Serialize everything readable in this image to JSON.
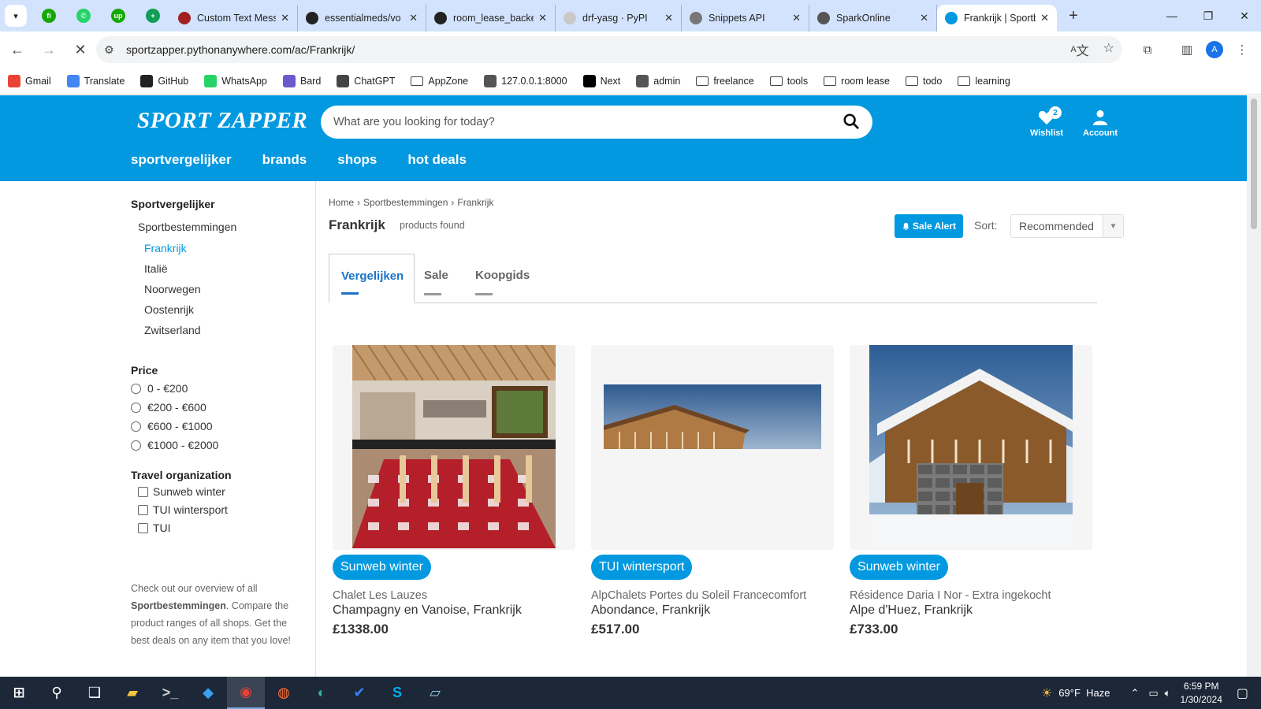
{
  "browser": {
    "pinned_tabs": [
      {
        "icon": "freelance-app-icon",
        "color": "#14a800",
        "glyph": "fi"
      },
      {
        "icon": "whatsapp-icon",
        "color": "#25d366",
        "glyph": "✆"
      },
      {
        "icon": "upwork-icon",
        "color": "#14a800",
        "glyph": "up"
      },
      {
        "icon": "sheets-icon",
        "color": "#0f9d58",
        "glyph": "+"
      }
    ],
    "tabs": [
      {
        "title": "Custom Text Mess",
        "icon": "custom-text-icon",
        "color": "#a02020",
        "active": false
      },
      {
        "title": "essentialmeds/vo",
        "icon": "github-icon",
        "color": "#222222",
        "active": false
      },
      {
        "title": "room_lease_backe",
        "icon": "github-icon",
        "color": "#222222",
        "active": false
      },
      {
        "title": "drf-yasg · PyPI",
        "icon": "pypi-icon",
        "color": "#c9c9c9",
        "active": false
      },
      {
        "title": "Snippets API",
        "icon": "document-icon",
        "color": "#777777",
        "active": false
      },
      {
        "title": "SparkOnline",
        "icon": "globe-icon",
        "color": "#555555",
        "active": false
      },
      {
        "title": "Frankrijk | Sportbe",
        "icon": "sportzapper-icon",
        "color": "#0399e0",
        "active": true
      }
    ],
    "url": "sportzapper.pythonanywhere.com/ac/Frankrijk/",
    "profile_initial": "A",
    "bookmarks": [
      {
        "label": "Gmail",
        "icon": "gmail-icon",
        "color": "#ea4335",
        "folder": false
      },
      {
        "label": "Translate",
        "icon": "translate-icon",
        "color": "#4285f4",
        "folder": false
      },
      {
        "label": "GitHub",
        "icon": "github-icon",
        "color": "#222222",
        "folder": false
      },
      {
        "label": "WhatsApp",
        "icon": "whatsapp-icon",
        "color": "#25d366",
        "folder": false
      },
      {
        "label": "Bard",
        "icon": "bard-icon",
        "color": "#6a5acd",
        "folder": false
      },
      {
        "label": "ChatGPT",
        "icon": "chatgpt-icon",
        "color": "#444444",
        "folder": false
      },
      {
        "label": "AppZone",
        "icon": "folder-icon",
        "color": "",
        "folder": true
      },
      {
        "label": "127.0.0.1:8000",
        "icon": "globe-icon",
        "color": "#555555",
        "folder": false
      },
      {
        "label": "Next",
        "icon": "next-icon",
        "color": "#000000",
        "folder": false
      },
      {
        "label": "admin",
        "icon": "globe-icon",
        "color": "#555555",
        "folder": false
      },
      {
        "label": "freelance",
        "icon": "folder-icon",
        "color": "",
        "folder": true
      },
      {
        "label": "tools",
        "icon": "folder-icon",
        "color": "",
        "folder": true
      },
      {
        "label": "room lease",
        "icon": "folder-icon",
        "color": "",
        "folder": true
      },
      {
        "label": "todo",
        "icon": "folder-icon",
        "color": "",
        "folder": true
      },
      {
        "label": "learning",
        "icon": "folder-icon",
        "color": "",
        "folder": true
      }
    ]
  },
  "site": {
    "logo": "SPORT ZAPPER",
    "search_placeholder": "What are you looking for today?",
    "wishlist_label": "Wishlist",
    "wishlist_count": "2",
    "account_label": "Account",
    "nav": [
      "sportvergelijker",
      "brands",
      "shops",
      "hot deals"
    ],
    "brand_color": "#0399e0"
  },
  "sidebar": {
    "title": "Sportvergelijker",
    "category": "Sportbestemmingen",
    "subcategories": [
      {
        "label": "Frankrijk",
        "active": true
      },
      {
        "label": "Italië",
        "active": false
      },
      {
        "label": "Noorwegen",
        "active": false
      },
      {
        "label": "Oostenrijk",
        "active": false
      },
      {
        "label": "Zwitserland",
        "active": false
      }
    ],
    "price_heading": "Price",
    "price_options": [
      "0 - €200",
      "€200 - €600",
      "€600 - €1000",
      "€1000 - €2000"
    ],
    "travel_heading": "Travel organization",
    "travel_options": [
      "Sunweb winter",
      "TUI wintersport",
      "TUI"
    ],
    "info_pre": "Check out our overview of all ",
    "info_bold": "Sportbestemmingen",
    "info_post": ". Compare the product ranges of all shops. Get the best deals on any item that you love!"
  },
  "content": {
    "breadcrumb": [
      "Home",
      "Sportbestemmingen",
      "Frankrijk"
    ],
    "title": "Frankrijk",
    "products_found": "products found",
    "sale_alert": "Sale Alert",
    "sort_label": "Sort:",
    "sort_value": "Recommended",
    "tabs": [
      {
        "label": "Vergelijken",
        "active": true
      },
      {
        "label": "Sale",
        "active": false
      },
      {
        "label": "Koopgids",
        "active": false
      }
    ],
    "products": [
      {
        "shop": "Sunweb winter",
        "name": "Chalet Les Lauzes",
        "location": "Champagny en Vanoise, Frankrijk",
        "price": "£1338.00",
        "image": "chalet-interior-dining"
      },
      {
        "shop": "TUI wintersport",
        "name": "AlpChalets Portes du Soleil Francecomfort",
        "location": "Abondance, Frankrijk",
        "price": "£517.00",
        "image": "chalet-roof-sky"
      },
      {
        "shop": "Sunweb winter",
        "name": "Résidence Daria I Nor - Extra ingekocht",
        "location": "Alpe d'Huez, Frankrijk",
        "price": "£733.00",
        "image": "chalet-exterior-snow"
      }
    ]
  },
  "taskbar": {
    "apps": [
      "start-icon",
      "search-icon",
      "task-view-icon",
      "file-explorer-icon",
      "terminal-icon",
      "vscode-icon",
      "chrome-icon",
      "firefox-icon",
      "edge-icon",
      "todo-icon",
      "skype-icon",
      "notepad-icon"
    ],
    "weather": "69°F  Haze",
    "time": "6:59 PM",
    "date": "1/30/2024"
  }
}
